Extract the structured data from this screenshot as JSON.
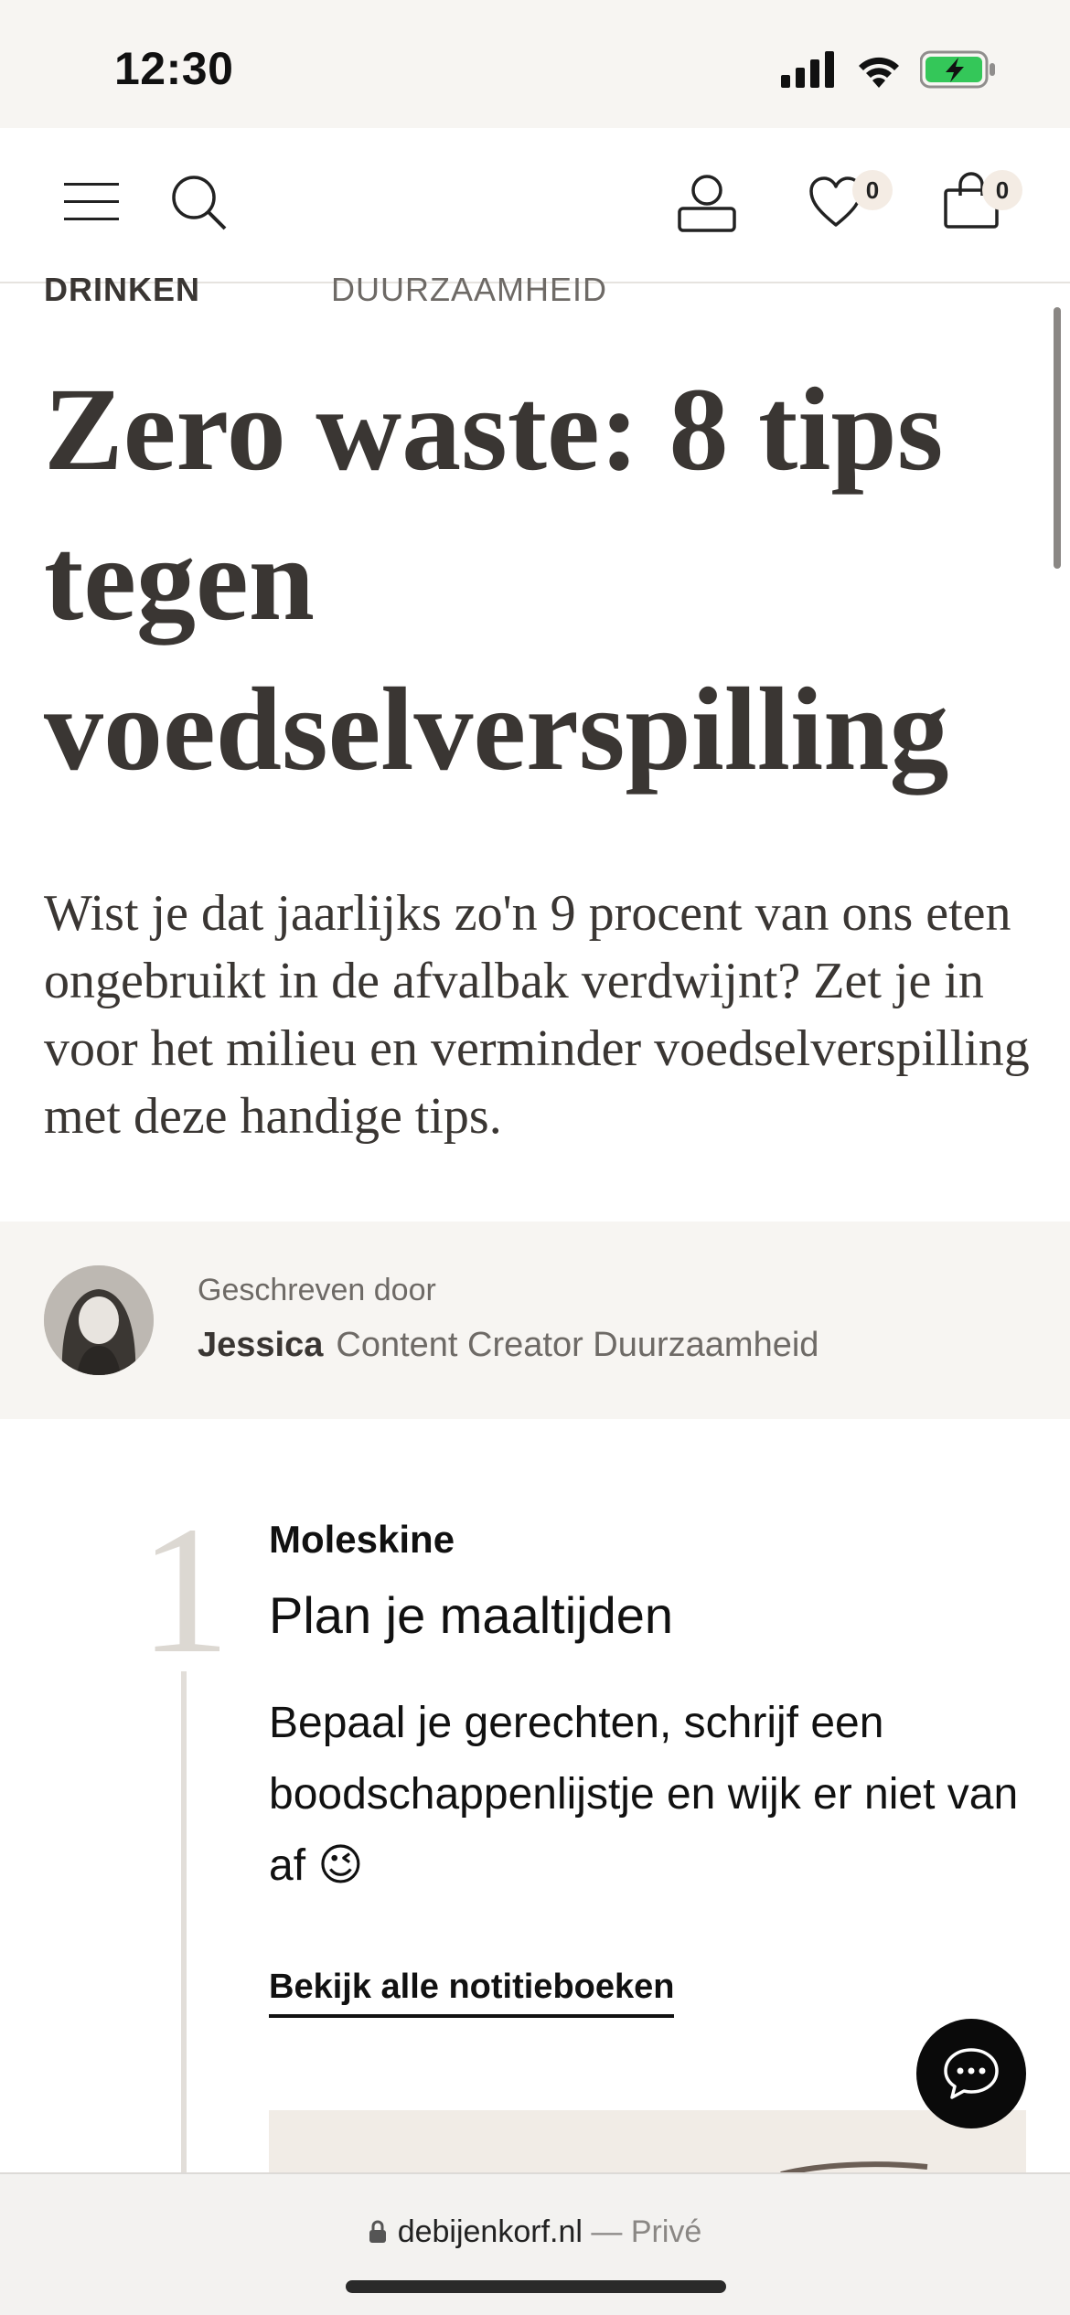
{
  "status_bar": {
    "time": "12:30"
  },
  "header": {
    "wishlist_count": "0",
    "cart_count": "0"
  },
  "article": {
    "categories": [
      "DRINKEN",
      "DUURZAAMHEID"
    ],
    "title": "Zero waste: 8 tips tegen voedselverspilling",
    "intro": "Wist je dat jaarlijks zo'n 9 procent van ons eten ongebruikt in de afvalbak verdwijnt? Zet je in voor het milieu en verminder voedselverspilling met deze handige tips.",
    "author": {
      "prefix": "Geschreven door",
      "name": "Jessica",
      "role": "Content Creator Duurzaamheid"
    },
    "tip": {
      "number": "1",
      "brand": "Moleskine",
      "heading": "Plan je maaltijden",
      "text": "Bepaal je gerechten, schrijf een boodschappenlijstje en wijk er niet van af 😉",
      "link": "Bekijk alle notitieboeken"
    }
  },
  "browser": {
    "host": "debijenkorf.nl",
    "mode": "— Privé"
  },
  "colors": {
    "status_bg": "#f7f5f2",
    "text": "#3a3633",
    "battery": "#34c759",
    "badge_bg": "#f4ece4"
  }
}
